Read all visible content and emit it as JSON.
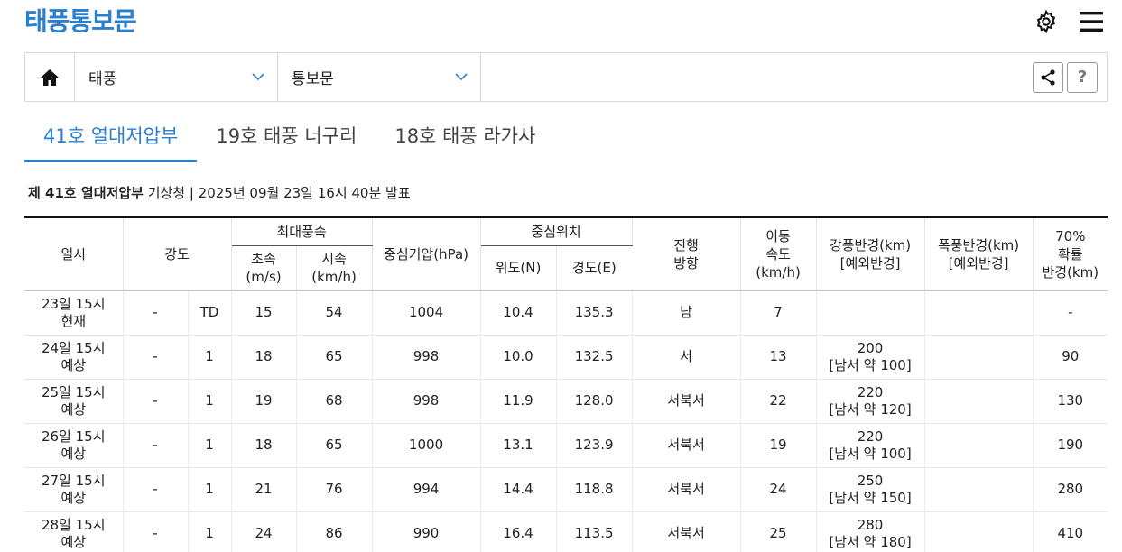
{
  "header": {
    "title": "태풍통보문"
  },
  "nav": {
    "select1": "태풍",
    "select2": "통보문",
    "help_label": "?"
  },
  "tabs": [
    {
      "label": "41호 열대저압부"
    },
    {
      "label": "19호 태풍 너구리"
    },
    {
      "label": "18호 태풍 라가사"
    }
  ],
  "info": {
    "name": "제 41호 열대저압부",
    "detail": " 기상청 | 2025년 09월 23일 16시 40분 발표"
  },
  "table": {
    "headers": {
      "datetime": "일시",
      "intensity": "강도",
      "max_wind": "최대풍속",
      "wind_ms": "초속",
      "wind_ms_unit": "(m/s)",
      "wind_kmh": "시속",
      "wind_kmh_unit": "(km/h)",
      "pressure": "중심기압(hPa)",
      "center": "중심위치",
      "lat": "위도(N)",
      "lon": "경도(E)",
      "direction_1": "진행",
      "direction_2": "방향",
      "speed_1": "이동",
      "speed_2": "속도",
      "speed_3": "(km/h)",
      "strong_radius_1": "강풍반경(km)",
      "strong_radius_2": "[예외반경]",
      "storm_radius_1": "폭풍반경(km)",
      "storm_radius_2": "[예외반경]",
      "prob_1": "70%",
      "prob_2": "확률",
      "prob_3": "반경(km)"
    },
    "rows": [
      {
        "dt1": "23일 15시",
        "dt2": "현재",
        "size": "-",
        "grade": "TD",
        "ms": "15",
        "kmh": "54",
        "pres": "1004",
        "lat": "10.4",
        "lon": "135.3",
        "dir": "남",
        "spd": "7",
        "sr1": "",
        "sr2": "",
        "stm": "",
        "prob": "-"
      },
      {
        "dt1": "24일 15시",
        "dt2": "예상",
        "size": "-",
        "grade": "1",
        "ms": "18",
        "kmh": "65",
        "pres": "998",
        "lat": "10.0",
        "lon": "132.5",
        "dir": "서",
        "spd": "13",
        "sr1": "200",
        "sr2": "[남서 약 100]",
        "stm": "",
        "prob": "90"
      },
      {
        "dt1": "25일 15시",
        "dt2": "예상",
        "size": "-",
        "grade": "1",
        "ms": "19",
        "kmh": "68",
        "pres": "998",
        "lat": "11.9",
        "lon": "128.0",
        "dir": "서북서",
        "spd": "22",
        "sr1": "220",
        "sr2": "[남서 약 120]",
        "stm": "",
        "prob": "130"
      },
      {
        "dt1": "26일 15시",
        "dt2": "예상",
        "size": "-",
        "grade": "1",
        "ms": "18",
        "kmh": "65",
        "pres": "1000",
        "lat": "13.1",
        "lon": "123.9",
        "dir": "서북서",
        "spd": "19",
        "sr1": "220",
        "sr2": "[남서 약 100]",
        "stm": "",
        "prob": "190"
      },
      {
        "dt1": "27일 15시",
        "dt2": "예상",
        "size": "-",
        "grade": "1",
        "ms": "21",
        "kmh": "76",
        "pres": "994",
        "lat": "14.4",
        "lon": "118.8",
        "dir": "서북서",
        "spd": "24",
        "sr1": "250",
        "sr2": "[남서 약 150]",
        "stm": "",
        "prob": "280"
      },
      {
        "dt1": "28일 15시",
        "dt2": "예상",
        "size": "-",
        "grade": "1",
        "ms": "24",
        "kmh": "86",
        "pres": "990",
        "lat": "16.4",
        "lon": "113.5",
        "dir": "서북서",
        "spd": "25",
        "sr1": "280",
        "sr2": "[남서 약 180]",
        "stm": "",
        "prob": "410"
      }
    ]
  },
  "colors": {
    "accent": "#2b7fd0"
  }
}
